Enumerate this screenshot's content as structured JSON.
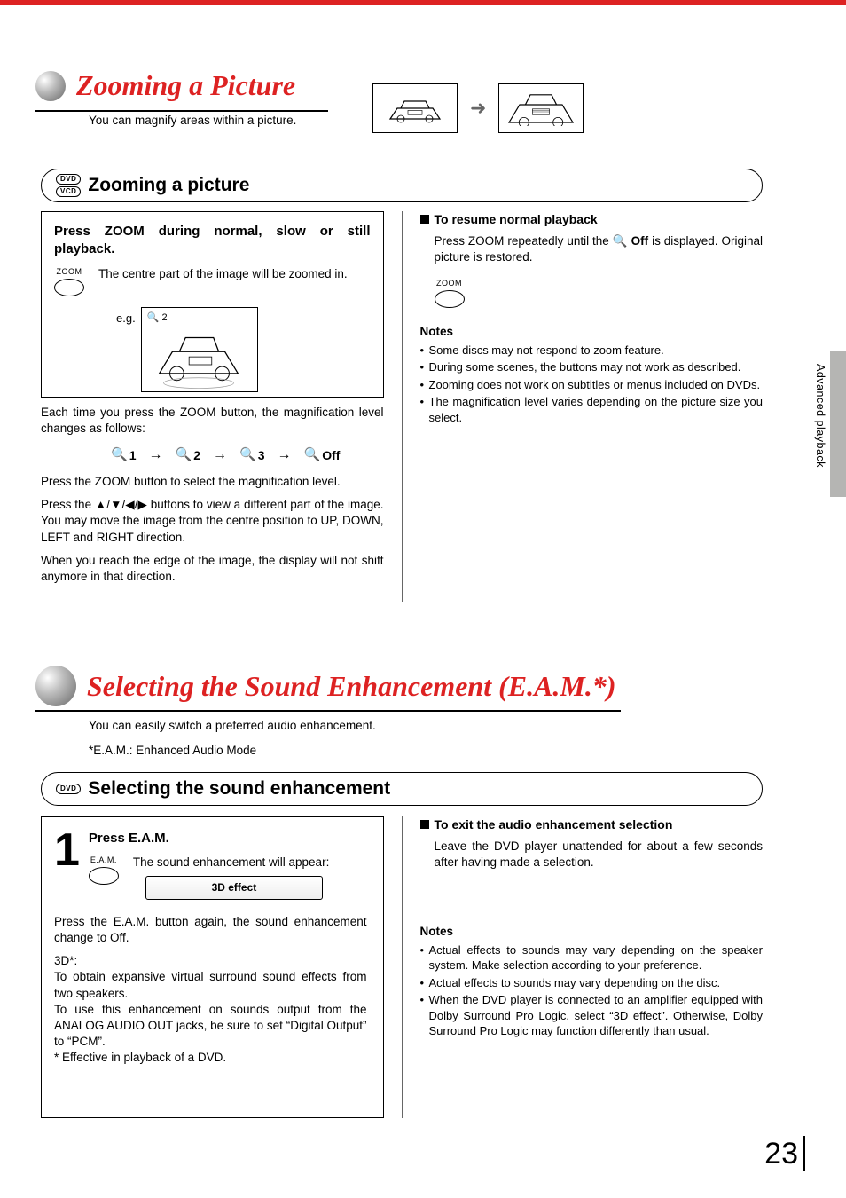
{
  "side_tab": "Advanced playback",
  "page_number": "23",
  "section1": {
    "title": "Zooming a Picture",
    "subtitle": "You can magnify areas within a picture.",
    "header_badges": [
      "DVD",
      "VCD"
    ],
    "header_text": "Zooming a picture",
    "left": {
      "box_title": "Press ZOOM during normal, slow or still playback.",
      "zoom_btn_label": "ZOOM",
      "zoom_desc": "The centre part of the image will be zoomed in.",
      "eg_label": "e.g.",
      "eg_corner": "🔍 2",
      "each_time": "Each time you press the ZOOM button, the magnification level changes as follows:",
      "seq": [
        "1",
        "2",
        "3",
        "Off"
      ],
      "p1": "Press the ZOOM button to select the magnification level.",
      "p2": "Press the ▲/▼/◀/▶ buttons to view a different part of the image. You may move the image from the centre position to UP, DOWN, LEFT and RIGHT direction.",
      "p3": "When you reach the edge of the image, the display will not shift anymore in that direction."
    },
    "right": {
      "resume_head": "To resume normal playback",
      "resume_body_a": "Press ZOOM repeatedly until the ",
      "resume_body_b": " is displayed. Original picture is restored.",
      "resume_icon_text": "Off",
      "zoom_btn_label": "ZOOM",
      "notes_title": "Notes",
      "notes": [
        "Some discs may not respond to zoom feature.",
        "During some scenes, the buttons may not work as described.",
        "Zooming does not work on subtitles or menus included on DVDs.",
        "The magnification level varies depending on the picture size you select."
      ]
    }
  },
  "section2": {
    "title": "Selecting the Sound Enhancement (E.A.M.*)",
    "subtitle": "You can easily switch a preferred audio enhancement.",
    "footnote": "*E.A.M.: Enhanced Audio Mode",
    "header_badges": [
      "DVD"
    ],
    "header_text": "Selecting the sound enhancement",
    "left": {
      "step_num": "1",
      "step_head": "Press E.A.M.",
      "btn_label": "E.A.M.",
      "appear": "The sound enhancement will appear:",
      "pill": "3D effect",
      "p1": "Press the E.A.M. button again, the sound enhancement change to Off.",
      "p2_head": "3D*:",
      "p2": "To obtain expansive virtual surround sound effects from two speakers.",
      "p3": "To use this enhancement on sounds output from the ANALOG AUDIO OUT jacks, be sure to set “Digital Output” to “PCM”.",
      "p4": "* Effective in playback of a DVD."
    },
    "right": {
      "exit_head": "To exit the audio enhancement selection",
      "exit_body": "Leave the DVD player unattended for about a few seconds after having made a selection.",
      "notes_title": "Notes",
      "notes": [
        "Actual effects to sounds may vary depending on the speaker system. Make selection according to your preference.",
        "Actual effects to sounds may vary depending on the disc.",
        "When the DVD player is connected to an amplifier equipped with Dolby Surround Pro Logic, select “3D effect”. Otherwise, Dolby Surround Pro Logic may function differently than usual."
      ]
    }
  }
}
